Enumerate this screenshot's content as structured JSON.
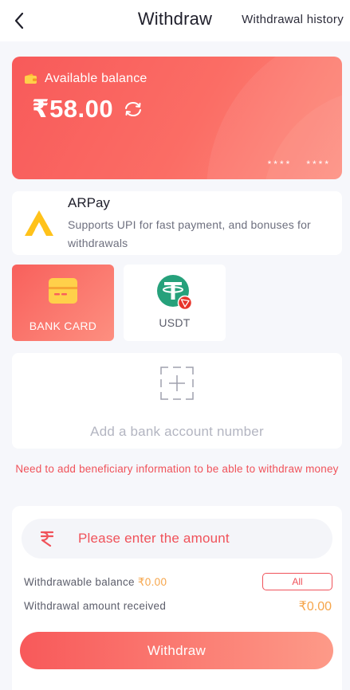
{
  "header": {
    "title": "Withdraw",
    "history_link": "Withdrawal history",
    "back_icon": "chevron-left-icon"
  },
  "balance_card": {
    "label": "Available balance",
    "amount": "₹58.00",
    "mask_left": "****",
    "mask_right": "****",
    "wallet_icon": "wallet-icon",
    "refresh_icon": "refresh-icon"
  },
  "arpay": {
    "title": "ARPay",
    "description": "Supports UPI for fast payment, and bonuses for withdrawals",
    "logo_icon": "arpay-logo-icon"
  },
  "methods": [
    {
      "label": "BANK CARD",
      "icon": "bank-card-icon",
      "selected": true
    },
    {
      "label": "USDT",
      "icon": "tether-icon",
      "selected": false
    }
  ],
  "add_bank": {
    "label": "Add a bank account number",
    "icon": "add-plus-icon"
  },
  "warning": "Need to add beneficiary information to be able to withdraw money",
  "amount_form": {
    "placeholder": "Please enter the amount",
    "value": "",
    "withdrawable_label": "Withdrawable balance",
    "withdrawable_value": "₹0.00",
    "all_button": "All",
    "received_label": "Withdrawal amount received",
    "received_value": "₹0.00",
    "submit": "Withdraw"
  },
  "colors": {
    "accent": "#f8595a",
    "accent_light": "#fd9a88",
    "highlight": "#f6a54a",
    "background": "#f6f7fb",
    "tether_green": "#26a17b",
    "tron_red": "#e8342b"
  }
}
